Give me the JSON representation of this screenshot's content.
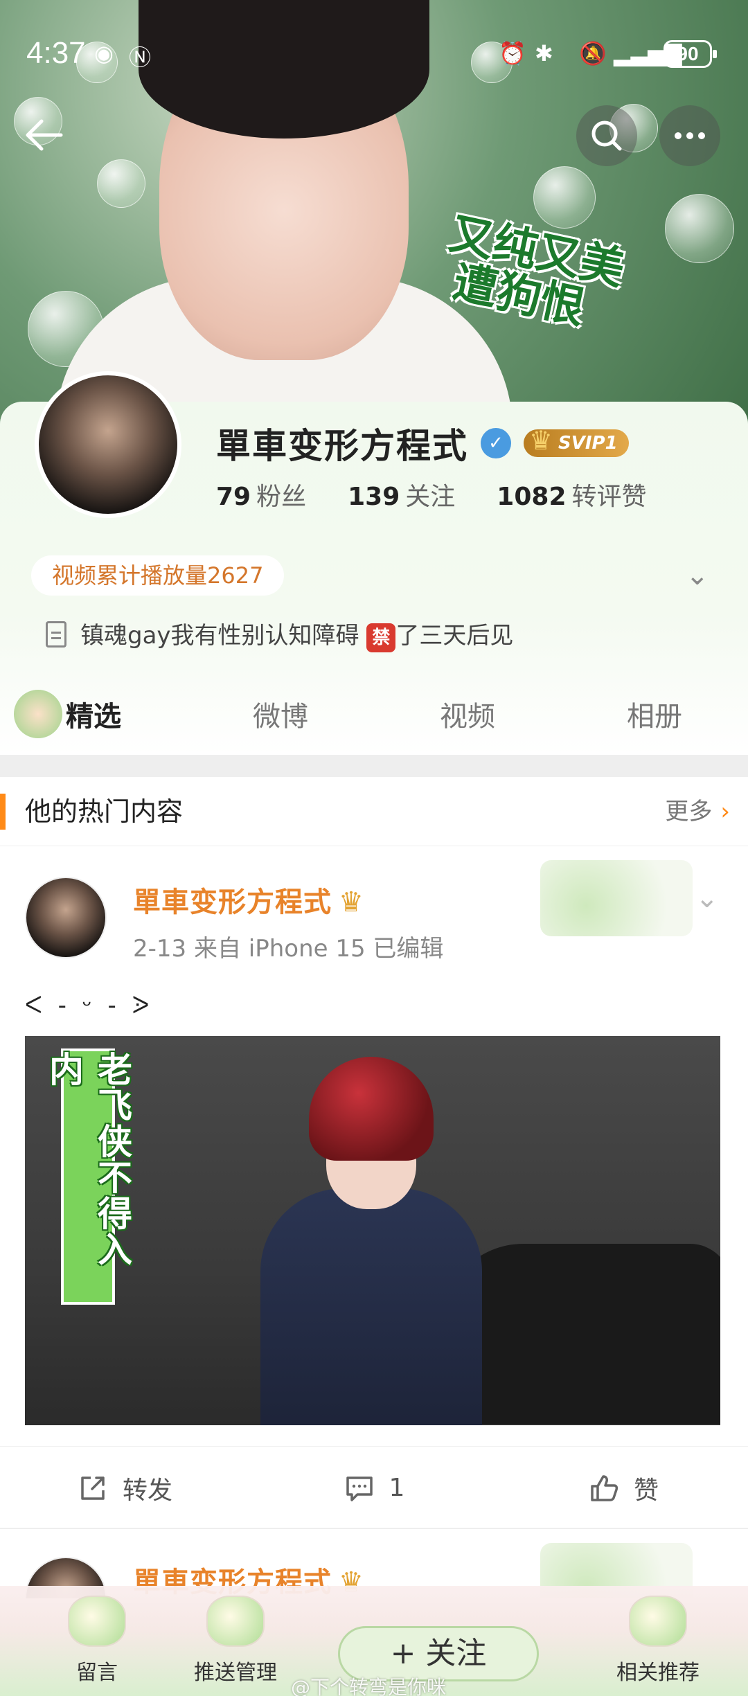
{
  "status_bar": {
    "time": "4:37",
    "battery": "90"
  },
  "banner": {
    "sticker_text": "又纯又美\n遭狗恨"
  },
  "profile": {
    "name": "單車变形方程式",
    "svip_badge": "SVIP1",
    "stats": [
      {
        "num": "79",
        "label": "粉丝"
      },
      {
        "num": "139",
        "label": "关注"
      },
      {
        "num": "1082",
        "label": "转评赞"
      }
    ],
    "plays": "视频累计播放量2627",
    "bio_before": "镇魂gay我有性别认知障碍",
    "ban_badge": "禁",
    "bio_after": "了三天后见"
  },
  "tabs": [
    "精选",
    "微博",
    "视频",
    "相册"
  ],
  "hot": {
    "title": "他的热门内容",
    "more": "更多"
  },
  "post": {
    "author": "單車变形方程式",
    "meta": "2-13  来自 iPhone 15  已编辑",
    "text": "ᐸ - ᵕ - ᐷ",
    "image_caption": "老飞侠不得入内",
    "actions": {
      "repost": "转发",
      "comments": "1",
      "like": "赞"
    }
  },
  "post2": {
    "author": "單車变形方程式"
  },
  "bottom_bar": {
    "message": "留言",
    "push": "推送管理",
    "follow": "+ 关注",
    "related": "相关推荐",
    "watermark": "@下个转弯是你咪"
  },
  "colors": {
    "accent_orange": "#ff8a17",
    "author_orange": "#e8832a",
    "svip_gold": "#e3a94a"
  },
  "icons": [
    "back-arrow-icon",
    "search-icon",
    "more-dots-icon",
    "repost-icon",
    "comment-icon",
    "like-icon"
  ]
}
